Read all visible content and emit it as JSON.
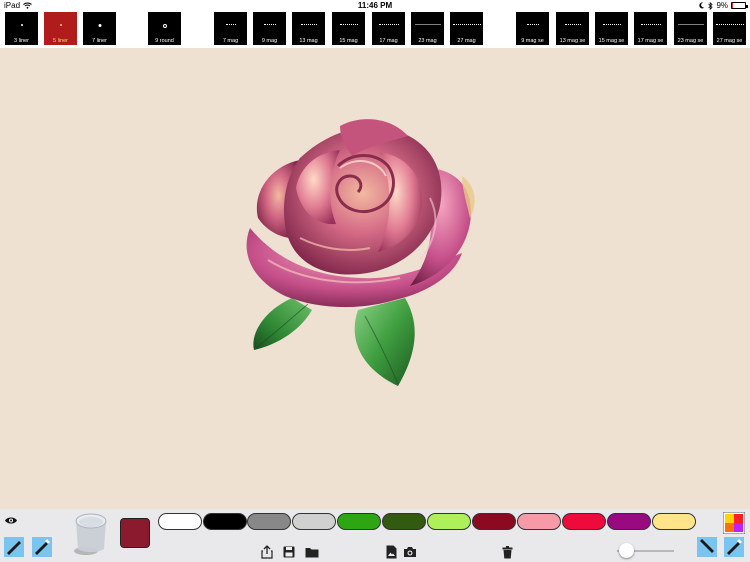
{
  "status": {
    "device": "iPad",
    "time": "11:46 PM",
    "battery": "9%",
    "battery_level": 0.09
  },
  "brushes": [
    {
      "label": "3 liner"
    },
    {
      "label": "5 liner",
      "selected": true
    },
    {
      "label": "7 liner"
    },
    {
      "label": "9 round"
    },
    {
      "label": "7 mag"
    },
    {
      "label": "9 mag"
    },
    {
      "label": "13 mag"
    },
    {
      "label": "15 mag"
    },
    {
      "label": "17 mag"
    },
    {
      "label": "23 mag"
    },
    {
      "label": "27 mag"
    },
    {
      "label": "9 mag se"
    },
    {
      "label": "13 mag se"
    },
    {
      "label": "15 mag se"
    },
    {
      "label": "17 mag se"
    },
    {
      "label": "23 mag se"
    },
    {
      "label": "27 mag se"
    }
  ],
  "canvas": {
    "background": "#efe1d1",
    "artwork": "rose-drawing"
  },
  "current_color": "#8b1a2f",
  "palette": [
    "#ffffff",
    "#000000",
    "#888888",
    "#d0d0d0",
    "#2ea614",
    "#325a10",
    "#aef05a",
    "#8b0a22",
    "#f59aa6",
    "#ee0a3a",
    "#990a80",
    "#ffe48a"
  ],
  "color_picker_quadrants": [
    "#ffd400",
    "#ff2020",
    "#ff7000",
    "#c020ff"
  ],
  "icons": {
    "eye": "eye-icon",
    "share": "share-icon",
    "save": "save-icon",
    "folder": "folder-icon",
    "image": "image-file-icon",
    "camera": "camera-icon",
    "trash": "trash-icon"
  },
  "brush_size_slider": {
    "value": 0.05
  }
}
